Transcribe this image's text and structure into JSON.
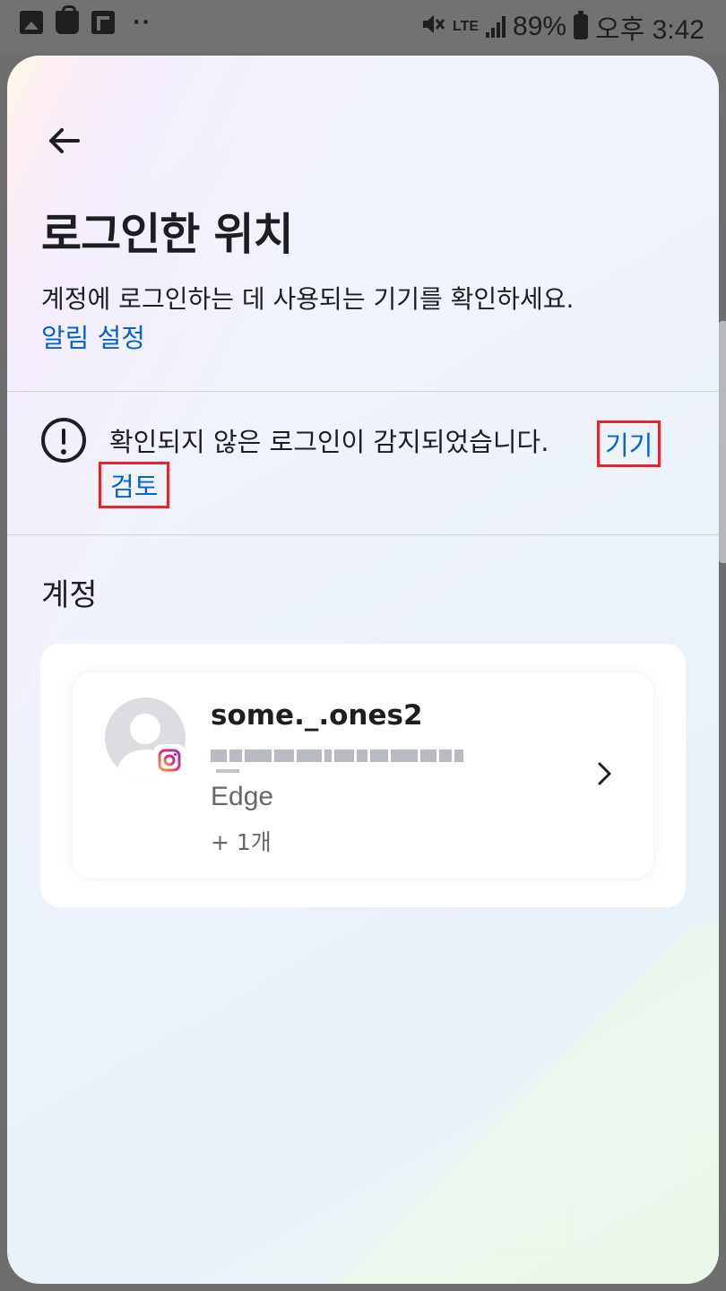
{
  "status_bar": {
    "network": "LTE",
    "battery": "89%",
    "time": "오후 3:42",
    "dots": "··"
  },
  "page": {
    "title": "로그인한 위치",
    "description": "계정에 로그인하는 데 사용되는 기기를 확인하세요.",
    "notification_link": "알림 설정"
  },
  "alert": {
    "text": "확인되지 않은 로그인이 감지되었습니다.",
    "review_link_part1": "기기",
    "review_link_part2": "검토"
  },
  "accounts": {
    "section_title": "계정",
    "items": [
      {
        "username": "some._.ones2",
        "browser": "Edge",
        "more": "+ 1개",
        "platform_icon": "instagram-icon"
      }
    ]
  },
  "colors": {
    "link": "#0064d1",
    "highlight_box": "#e0262e",
    "text": "#1c1e21"
  }
}
